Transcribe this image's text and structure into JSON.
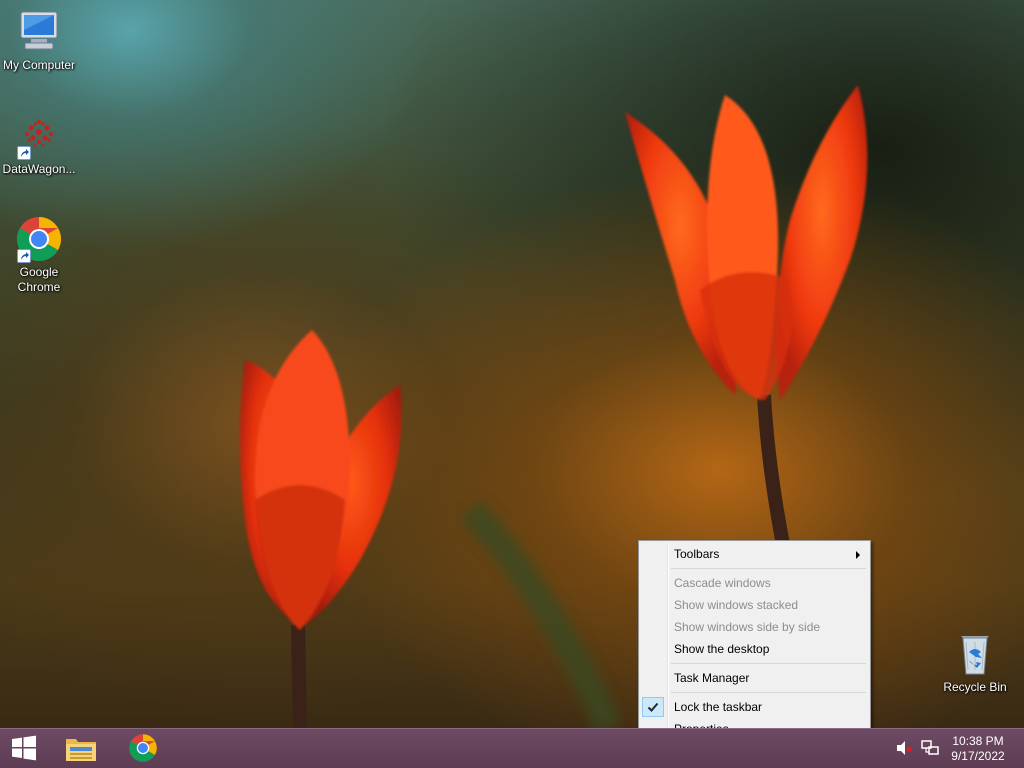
{
  "desktop": {
    "icons": [
      {
        "label": "My Computer",
        "icon": "computer-icon"
      },
      {
        "label": "DataWagon...",
        "icon": "datawagon-icon"
      },
      {
        "label": "Google\nChrome",
        "icon": "chrome-icon"
      },
      {
        "label": "Recycle Bin",
        "icon": "recycle-bin-icon"
      }
    ]
  },
  "context_menu": {
    "items": [
      {
        "label": "Toolbars",
        "enabled": true,
        "submenu": true
      },
      {
        "label": "Cascade windows",
        "enabled": false
      },
      {
        "label": "Show windows stacked",
        "enabled": false
      },
      {
        "label": "Show windows side by side",
        "enabled": false
      },
      {
        "label": "Show the desktop",
        "enabled": true
      },
      {
        "label": "Task Manager",
        "enabled": true
      },
      {
        "label": "Lock the taskbar",
        "enabled": true,
        "checked": true
      },
      {
        "label": "Properties",
        "enabled": true
      }
    ]
  },
  "taskbar": {
    "start_icon": "windows-logo-icon",
    "pinned": [
      "file-explorer-icon",
      "chrome-icon"
    ],
    "tray": {
      "volume_icon": "volume-muted-icon",
      "network_icon": "network-icon",
      "time": "10:38 PM",
      "date": "9/17/2022"
    },
    "colors": {
      "taskbar": "#5d3c54",
      "menu_bg": "#f0f0f0",
      "check_bg": "#cde8f7"
    }
  }
}
